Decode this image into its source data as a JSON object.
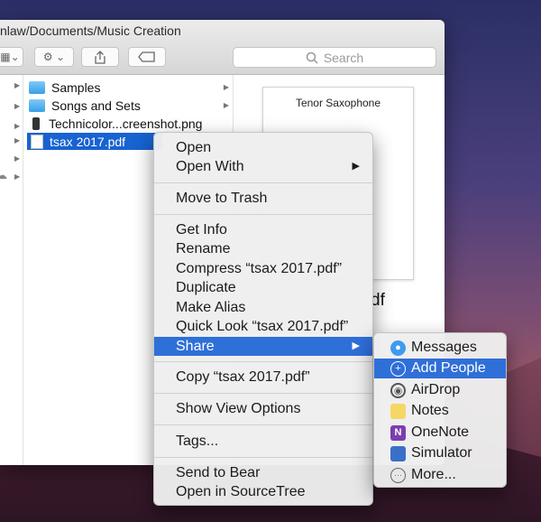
{
  "window": {
    "title": "nlaw/Documents/Music Creation",
    "search_placeholder": "Search"
  },
  "files": [
    {
      "name": "Samples",
      "icon": "folder-icon"
    },
    {
      "name": "Songs and Sets",
      "icon": "folder-icon"
    },
    {
      "name": "Technicolor...creenshot.png",
      "icon": "phone-screenshot-icon"
    },
    {
      "name": "tsax 2017.pdf",
      "icon": "pdf-icon",
      "selected": true
    }
  ],
  "preview": {
    "title": "Tenor Saxophone",
    "name_fragment": "df"
  },
  "context_menu": {
    "items": [
      {
        "label": "Open"
      },
      {
        "label": "Open With",
        "submenu": true
      },
      {
        "label": "Move to Trash"
      },
      {
        "label": "Get Info"
      },
      {
        "label": "Rename"
      },
      {
        "label": "Compress “tsax 2017.pdf”"
      },
      {
        "label": "Duplicate"
      },
      {
        "label": "Make Alias"
      },
      {
        "label": "Quick Look “tsax 2017.pdf”"
      },
      {
        "label": "Share",
        "submenu": true,
        "highlighted": true
      },
      {
        "label": "Copy “tsax 2017.pdf”"
      },
      {
        "label": "Show View Options"
      },
      {
        "label": "Tags..."
      },
      {
        "label": "Send to Bear"
      },
      {
        "label": "Open in SourceTree"
      }
    ]
  },
  "share_menu": {
    "items": [
      {
        "label": "Messages",
        "icon": "messages-icon"
      },
      {
        "label": "Add People",
        "icon": "add-people-icon",
        "highlighted": true
      },
      {
        "label": "AirDrop",
        "icon": "airdrop-icon"
      },
      {
        "label": "Notes",
        "icon": "notes-icon"
      },
      {
        "label": "OneNote",
        "icon": "onenote-icon"
      },
      {
        "label": "Simulator",
        "icon": "simulator-icon"
      },
      {
        "label": "More...",
        "icon": "more-icon"
      }
    ]
  },
  "colors": {
    "selection": "#1763d1",
    "menu_highlight": "#2f6fd8",
    "folder": "#3aa0e6"
  }
}
